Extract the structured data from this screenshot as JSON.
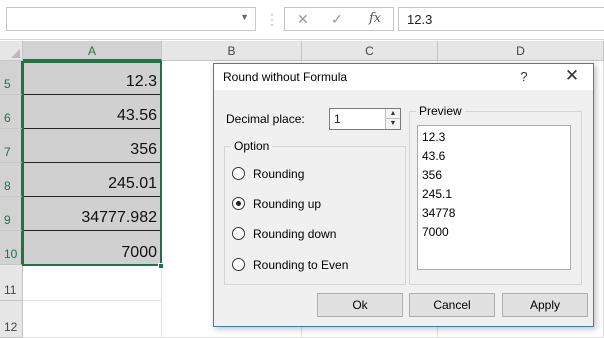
{
  "formula_bar": {
    "name_box": "",
    "cancel_icon": "✕",
    "enter_icon": "✓",
    "fx_label": "fx",
    "formula_value": "12.3"
  },
  "sheet": {
    "columns": [
      "A",
      "B",
      "C",
      "D"
    ],
    "rows": [
      "5",
      "6",
      "7",
      "8",
      "9",
      "10",
      "11",
      "12"
    ],
    "column_a_values": [
      "12.3",
      "43.56",
      "356",
      "245.01",
      "34777.982",
      "7000"
    ]
  },
  "dialog": {
    "title": "Round without Formula",
    "help_label": "?",
    "close_label": "✕",
    "decimal_place_label": "Decimal place:",
    "decimal_place_value": "1",
    "option_legend": "Option",
    "options": [
      {
        "label": "Rounding",
        "selected": false
      },
      {
        "label": "Rounding up",
        "selected": true
      },
      {
        "label": "Rounding down",
        "selected": false
      },
      {
        "label": "Rounding to Even",
        "selected": false
      }
    ],
    "preview_legend": "Preview",
    "preview_values": [
      "12.3",
      "43.6",
      "356",
      "245.1",
      "34778",
      "7000"
    ],
    "buttons": {
      "ok": "Ok",
      "cancel": "Cancel",
      "apply": "Apply"
    }
  },
  "colors": {
    "selection_green": "#217346",
    "dialog_border": "#3c7fb1",
    "selected_fill": "#d0d0d0"
  }
}
